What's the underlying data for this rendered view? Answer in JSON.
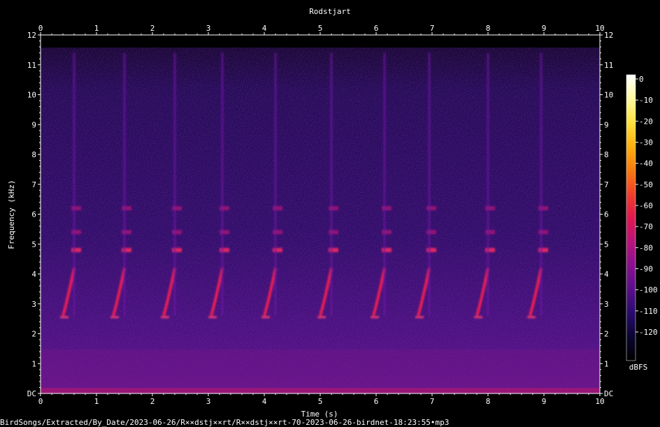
{
  "chart_data": {
    "type": "heatmap",
    "title": "Rodstjart",
    "xlabel": "Time (s)",
    "ylabel": "Frequency (kHz)",
    "xlim": [
      0,
      10
    ],
    "ylim": [
      0,
      12
    ],
    "x_ticks": [
      "0",
      "1",
      "2",
      "3",
      "4",
      "5",
      "6",
      "7",
      "8",
      "9",
      "10"
    ],
    "y_ticks": [
      "DC",
      "1",
      "2",
      "3",
      "4",
      "5",
      "6",
      "7",
      "8",
      "9",
      "10",
      "11",
      "12"
    ],
    "colorbar": {
      "label": "dBFS",
      "range": [
        -120,
        0
      ],
      "ticks": [
        "0",
        "-10",
        "-20",
        "-30",
        "-40",
        "-50",
        "-60",
        "-70",
        "-80",
        "-90",
        "-100",
        "-110",
        "-120"
      ],
      "colors": [
        "#000000",
        "#0a0530",
        "#2a0a6e",
        "#5a0f8a",
        "#8a1090",
        "#b8147a",
        "#e01850",
        "#f0402a",
        "#f87a10",
        "#fcb010",
        "#fde040",
        "#fff8a0",
        "#ffffff"
      ]
    },
    "note_onsets_s": [
      0.45,
      1.35,
      2.25,
      3.1,
      4.05,
      5.05,
      6.0,
      6.8,
      7.85,
      8.8
    ],
    "note_freq_range_khz": [
      2.6,
      4.2
    ],
    "harmonic_bands_khz": [
      4.8,
      5.4,
      6.2
    ]
  },
  "footer_path": "BirdSongs/Extracted/By_Date/2023-06-26/R××dstj××rt/R××dstj××rt-70-2023-06-26-birdnet-18:23:55•mp3"
}
